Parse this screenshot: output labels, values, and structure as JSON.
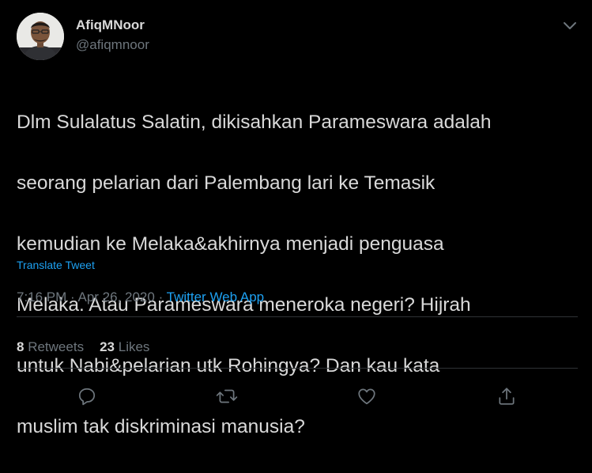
{
  "author": {
    "display_name": "AfiqMNoor",
    "handle": "@afiqmnoor",
    "avatar": "profile-photo"
  },
  "tweet": {
    "lines": [
      "Dlm Sulalatus Salatin, dikisahkan Parameswara adalah",
      "seorang pelarian dari Palembang lari ke Temasik",
      "kemudian ke Melaka&akhirnya menjadi penguasa",
      "Melaka. Atau Parameswara meneroka negeri? Hijrah",
      "untuk Nabi&pelarian utk Rohingya? Dan kau kata",
      "muslim tak diskriminasi manusia?"
    ],
    "translate_label": "Translate Tweet",
    "time": "7:16 PM",
    "separator": " · ",
    "date": "Apr 26, 2020",
    "source": "Twitter Web App"
  },
  "stats": {
    "retweets_count": "8",
    "retweets_label": "Retweets",
    "likes_count": "23",
    "likes_label": "Likes"
  },
  "actions": [
    "reply-icon",
    "retweet-icon",
    "like-icon",
    "share-icon"
  ],
  "colors": {
    "background": "#000000",
    "text": "#d9d9d9",
    "secondary": "#6e767d",
    "link": "#1da1f2",
    "divider": "#2f3336"
  }
}
